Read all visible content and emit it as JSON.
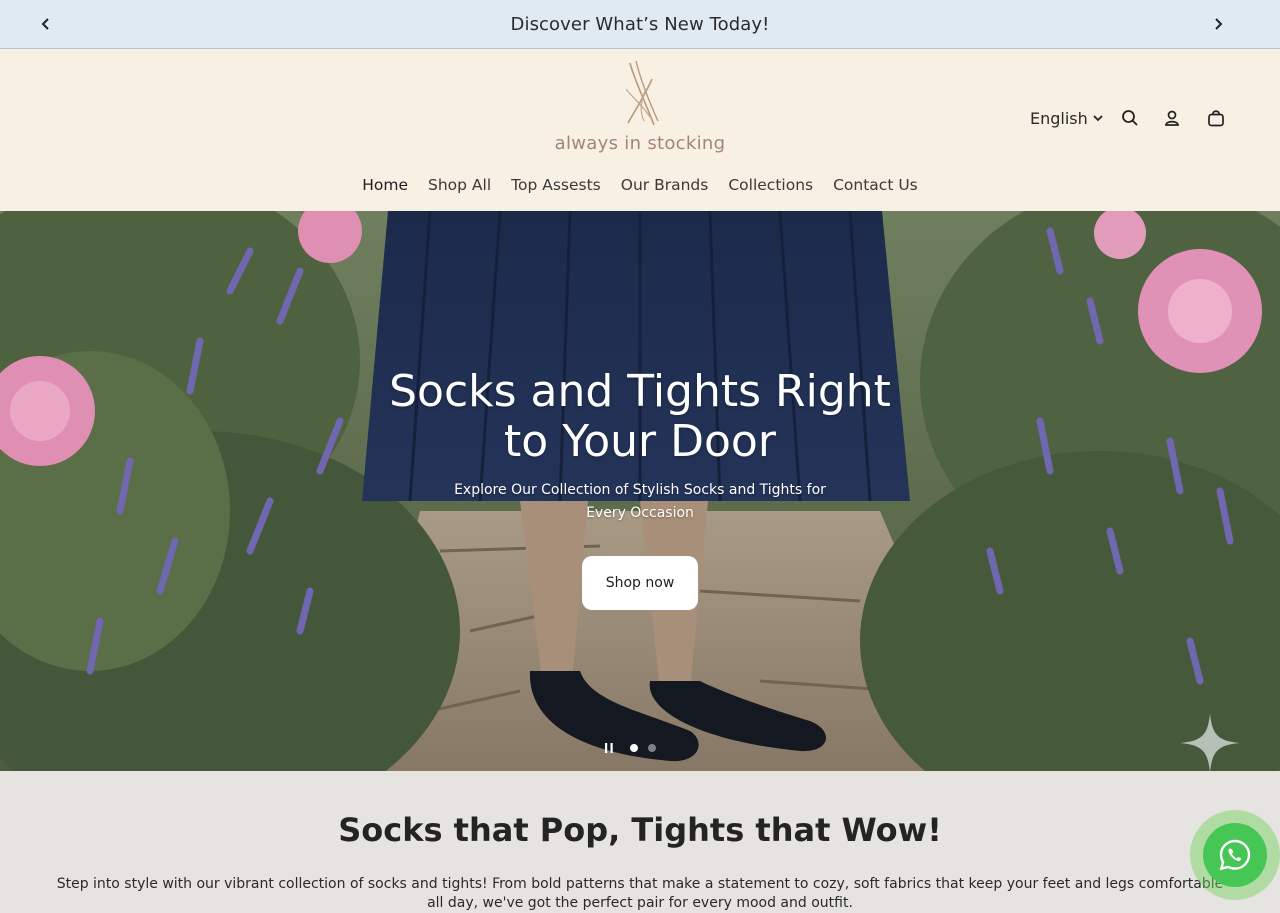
{
  "announcement": {
    "text": "Discover What’s New Today!",
    "prev_icon": "chevron-left-icon",
    "next_icon": "chevron-right-icon"
  },
  "header": {
    "logo_text": "always in stocking",
    "language": "English",
    "icons": [
      "search-icon",
      "account-icon",
      "cart-icon"
    ]
  },
  "nav": {
    "items": [
      "Home",
      "Shop All",
      "Top Assests",
      "Our Brands",
      "Collections",
      "Contact Us"
    ]
  },
  "hero": {
    "title_line1": "Socks and Tights Right",
    "title_line2": "to Your Door",
    "subtitle_line1": "Explore Our Collection of Stylish Socks and Tights for",
    "subtitle_line2": "Every Occasion",
    "button_label": "Shop now",
    "active_slide": 1,
    "slide_count": 2
  },
  "section": {
    "title": "Socks that Pop, Tights that Wow!",
    "text": "Step into style with our vibrant collection of socks and tights! From bold patterns that make a statement to cozy, soft fabrics that keep your feet and legs comfortable all day, we've got the perfect pair for every mood and outfit."
  },
  "colors": {
    "announcement_bg": "#dfeaf2",
    "header_bg": "#f7f0e3",
    "logo": "#a58478",
    "section_bg": "#e6e4e0",
    "whatsapp": "#46c655"
  }
}
